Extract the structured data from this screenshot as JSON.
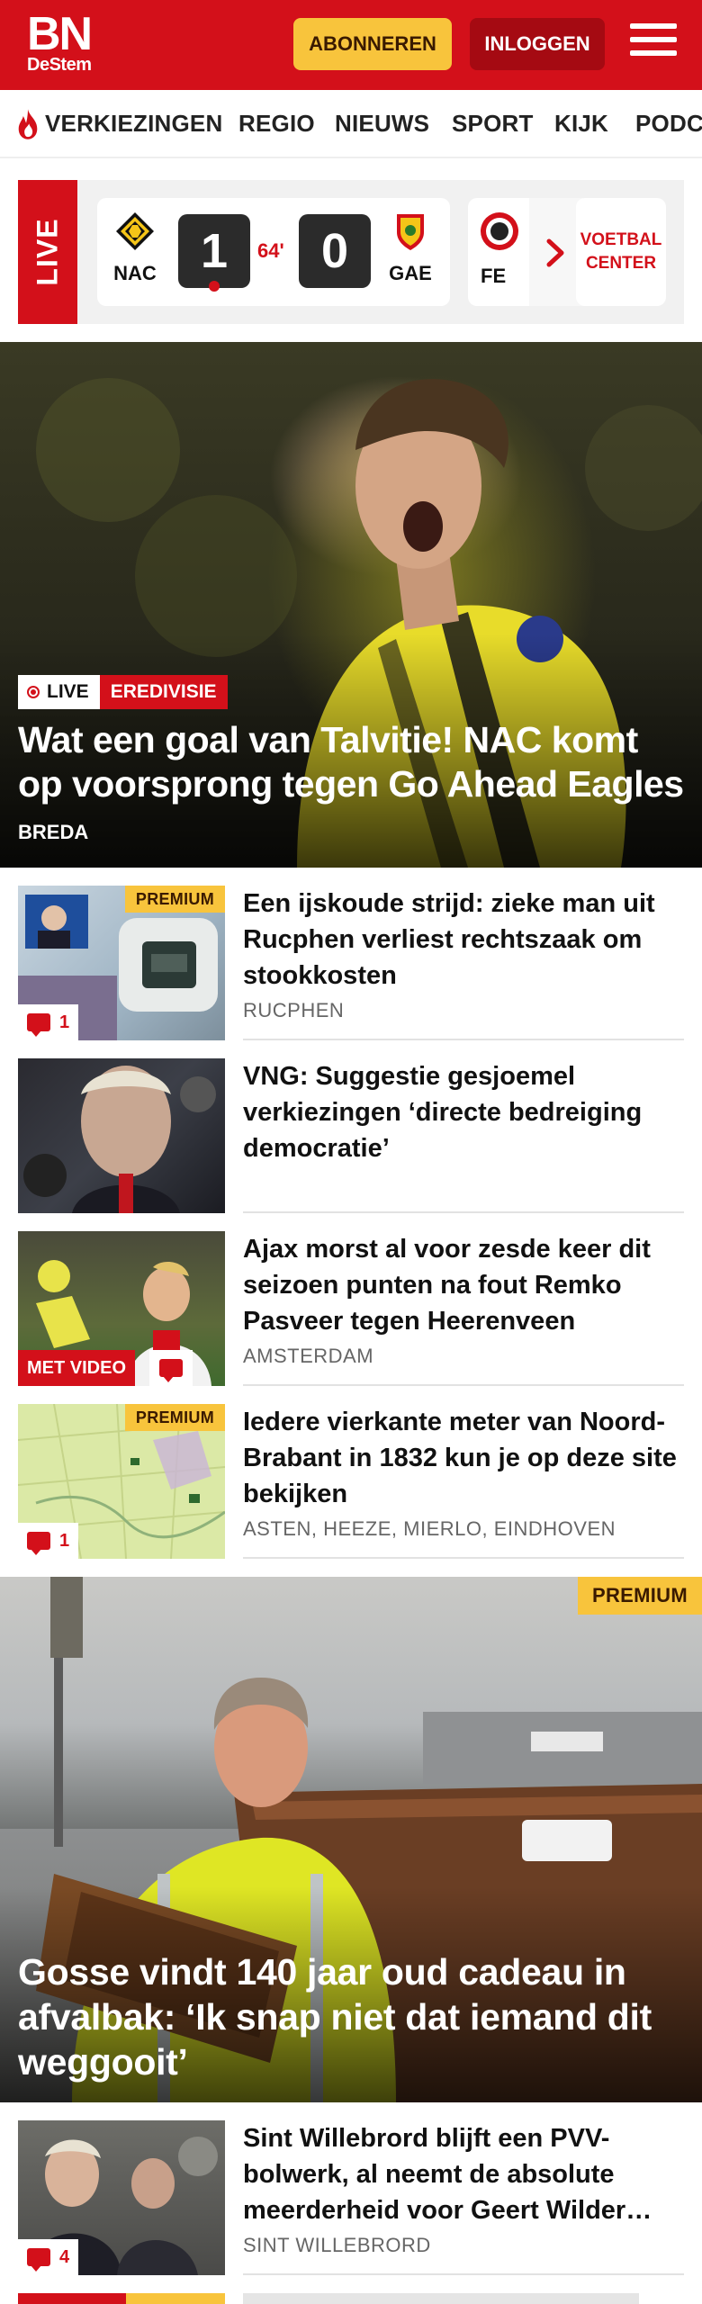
{
  "header": {
    "logo_main": "BN",
    "logo_sub": "DeStem",
    "subscribe_label": "ABONNEREN",
    "login_label": "INLOGGEN"
  },
  "nav": {
    "items": [
      "VERKIEZINGEN",
      "REGIO",
      "NIEUWS",
      "SPORT",
      "KIJK",
      "PODC"
    ]
  },
  "live": {
    "label": "LIVE",
    "match": {
      "home": "NAC",
      "away": "GAE",
      "home_score": "1",
      "away_score": "0",
      "minute": "64'"
    },
    "next_team": "FE",
    "voetbal_center": "VOETBAL CENTER"
  },
  "hero": {
    "tag_live": "LIVE",
    "tag_category": "EREDIVISIE",
    "title": "Wat een goal van Talvitie! NAC komt op voorsprong tegen Go Ahead Eagles",
    "location": "BREDA"
  },
  "articles": [
    {
      "title": "Een ijskoude strijd: zieke man uit Rucphen verliest rechtszaak om stookkosten",
      "location": "RUCPHEN",
      "premium": "PREMIUM",
      "comments": "1"
    },
    {
      "title": "VNG: Suggestie gesjoemel verkiezingen ‘directe bedreiging democratie’",
      "location": ""
    },
    {
      "title": "Ajax morst al voor zesde keer dit seizoen punten na fout Remko Pasveer tegen Heerenveen",
      "location": "AMSTERDAM",
      "video": "MET VIDEO"
    },
    {
      "title": "Iedere vierkante meter van Noord-Brabant in 1832 kun je op deze site bekijken",
      "location": "ASTEN, HEEZE, MIERLO, EINDHOVEN",
      "premium": "PREMIUM",
      "comments": "1"
    }
  ],
  "feature": {
    "premium": "PREMIUM",
    "title": "Gosse vindt 140 jaar oud cadeau in afvalbak: ‘Ik snap niet dat iemand dit weggooit’"
  },
  "article_after": {
    "title": "Sint Willebrord blijft een PVV-bolwerk, al neemt de absolute meerderheid voor Geert Wilder…",
    "location": "SINT WILLEBRORD",
    "comments": "4"
  },
  "colors": {
    "brand_red": "#d3101a",
    "premium_yellow": "#f8c43c"
  }
}
